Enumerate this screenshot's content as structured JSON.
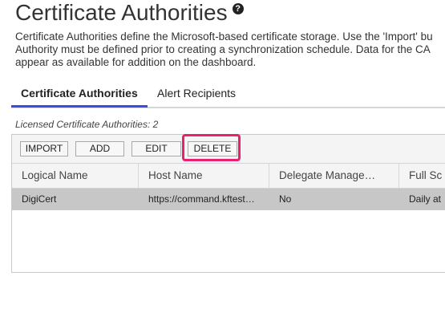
{
  "page": {
    "title": "Certificate Authorities",
    "help_icon": "?",
    "description_lines": [
      "Certificate Authorities define the Microsoft-based certificate storage. Use the 'Import' bu",
      "Authority must be defined prior to creating a synchronization schedule. Data for the CA",
      "appear as available for addition on the dashboard."
    ]
  },
  "tabs": [
    {
      "label": "Certificate Authorities",
      "active": true
    },
    {
      "label": "Alert Recipients",
      "active": false
    }
  ],
  "licensed_text": "Licensed Certificate Authorities: 2",
  "toolbar": {
    "import_label": "IMPORT",
    "add_label": "ADD",
    "edit_label": "EDIT",
    "delete_label": "DELETE",
    "highlight_color": "#e8206f"
  },
  "grid": {
    "columns": [
      "Logical Name",
      "Host Name",
      "Delegate Manage…",
      "Full Sc"
    ],
    "rows": [
      [
        "DigiCert",
        "https://command.kftest…",
        "No",
        "Daily at"
      ]
    ],
    "selected_row_color": "#c7c7c7"
  },
  "colors": {
    "tab_accent": "#3a4fe0"
  }
}
